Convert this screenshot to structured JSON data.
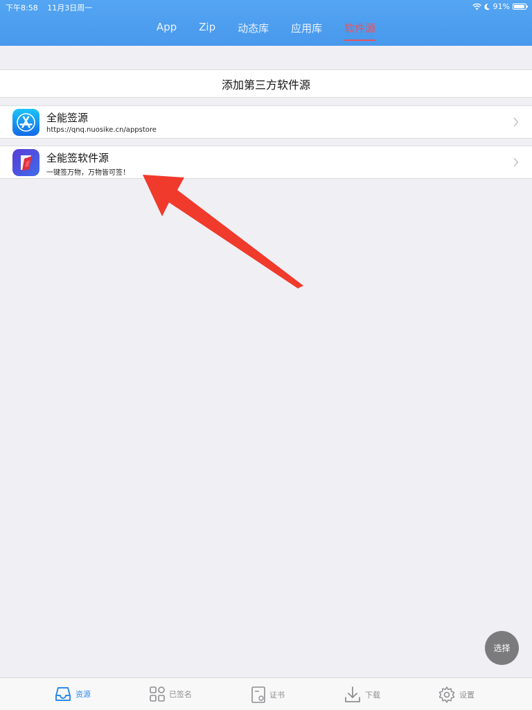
{
  "status_bar": {
    "time": "下午8:58",
    "date": "11月3日周一",
    "battery": "91%",
    "battery_level": 0.91
  },
  "tabs": [
    {
      "label": "App",
      "active": false
    },
    {
      "label": "Zip",
      "active": false
    },
    {
      "label": "动态库",
      "active": false
    },
    {
      "label": "应用库",
      "active": false
    },
    {
      "label": "软件源",
      "active": true
    }
  ],
  "add_source": {
    "label": "添加第三方软件源"
  },
  "sources": [
    {
      "title": "全能签源",
      "subtitle": "https://qnq.nuosike.cn/appstore",
      "icon": "app-store-icon"
    },
    {
      "title": "全能签软件源",
      "subtitle": "一键签万物，万物皆可签！",
      "icon": "quanneng-logo-icon"
    }
  ],
  "select_button": {
    "label": "选择"
  },
  "bottom_tabs": [
    {
      "label": "资源",
      "icon": "inbox-icon",
      "active": true
    },
    {
      "label": "已签名",
      "icon": "apps-grid-icon",
      "active": false
    },
    {
      "label": "证书",
      "icon": "certificate-icon",
      "active": false
    },
    {
      "label": "下载",
      "icon": "download-icon",
      "active": false
    },
    {
      "label": "设置",
      "icon": "gear-icon",
      "active": false
    }
  ],
  "colors": {
    "top_bar": "#4a9ef0",
    "active_tab": "#e8535d",
    "active_bottom": "#2f8ae8",
    "inactive_bottom": "#8e8e93",
    "arrow": "#f03a2c"
  }
}
